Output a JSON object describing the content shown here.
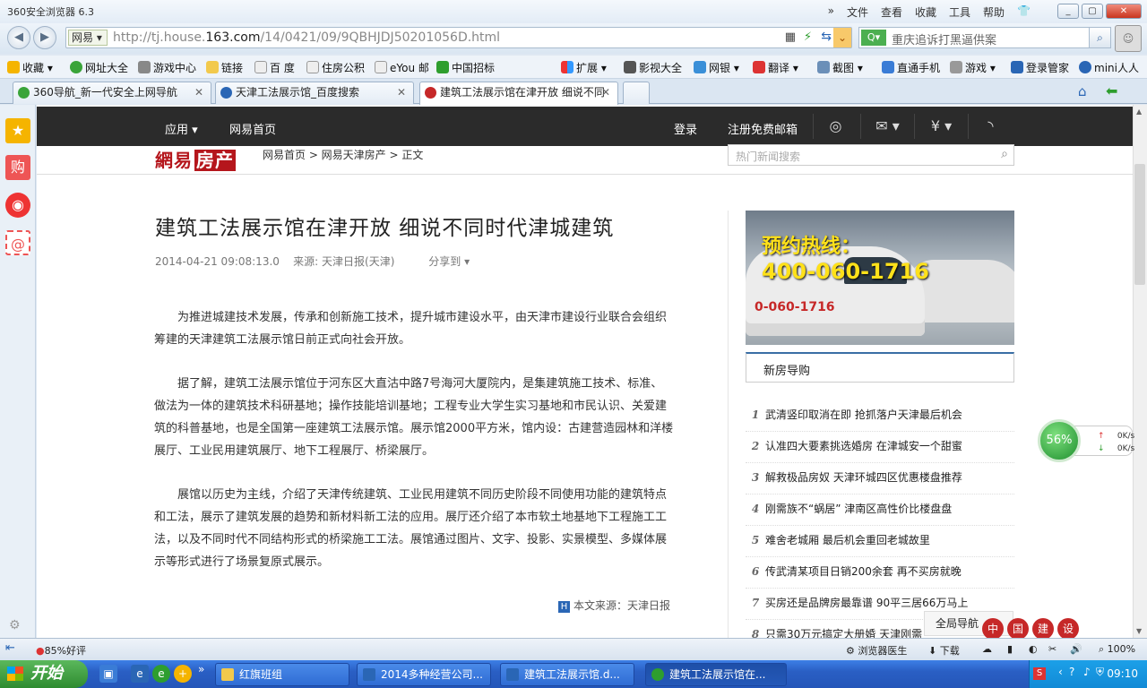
{
  "browser": {
    "title": "360安全浏览器 6.3",
    "menu": [
      "»",
      "文件",
      "查看",
      "收藏",
      "工具",
      "帮助"
    ],
    "window_buttons": [
      "_",
      "▢",
      "✕"
    ],
    "address": {
      "engine": "网易",
      "url_pre": "http://tj.house.",
      "url_domain": "163.com",
      "url_post": "/14/0421/09/9QBHJDJ50201056D.html"
    },
    "search": {
      "placeholder": "重庆追诉打黑逼供案"
    },
    "favorites": [
      "收藏",
      "网址大全",
      "游戏中心",
      "链接",
      "百 度",
      "住房公积",
      "eYou 邮",
      "中国招标",
      "扩展",
      "影视大全",
      "网银",
      "翻译",
      "截图",
      "直通手机",
      "游戏",
      "登录管家",
      "mini人人"
    ],
    "tabs": [
      {
        "label": "360导航_新一代安全上网导航",
        "close": "✕"
      },
      {
        "label": "天津工法展示馆_百度搜索",
        "close": "✕"
      },
      {
        "label": "建筑工法展示馆在津开放 细说不同",
        "close": "✕"
      }
    ]
  },
  "site": {
    "topnav": {
      "app": "应用",
      "home": "网易首页",
      "login": "登录",
      "register": "注册免费邮箱"
    },
    "logo": {
      "part1": "網易",
      "part2": "房产"
    },
    "breadcrumb": "网易首页  >  网易天津房产  >  正文",
    "news_search_placeholder": "热门新闻搜索"
  },
  "article": {
    "title": "建筑工法展示馆在津开放  细说不同时代津城建筑",
    "time": "2014-04-21 09:08:13.0",
    "source": "来源: 天津日报(天津)",
    "share": "分享到",
    "paragraphs": [
      "为推进城建技术发展，传承和创新施工技术，提升城市建设水平，由天津市建设行业联合会组织筹建的天津建筑工法展示馆日前正式向社会开放。",
      "据了解，建筑工法展示馆位于河东区大直沽中路7号海河大厦院内，是集建筑施工技术、标准、做法为一体的建筑技术科研基地；操作技能培训基地；工程专业大学生实习基地和市民认识、关爱建筑的科普基地，也是全国第一座建筑工法展示馆。展示馆2000平方米，馆内设：古建营造园林和洋楼展厅、工业民用建筑展厅、地下工程展厅、桥梁展厅。",
      "展馆以历史为主线，介绍了天津传统建筑、工业民用建筑不同历史阶段不同使用功能的建筑特点和工法，展示了建筑发展的趋势和新材料新工法的应用。展厅还介绍了本市软土地基地下工程施工工法，以及不同时代不同结构形式的桥梁施工工法。展馆通过图片、文字、投影、实景模型、多媒体展示等形式进行了场景复原式展示。"
    ],
    "origin": "本文来源：天津日报"
  },
  "ad": {
    "hotline_label": "预约热线：",
    "hotline_number": "400-060-1716",
    "van_text": "0-060-1716"
  },
  "sidebar_guide": {
    "title": "新房导购",
    "items": [
      {
        "n": "1",
        "text": "武清竖印取消在即  抢抓落户天津最后机会"
      },
      {
        "n": "2",
        "text": "认准四大要素挑选婚房  在津城安一个甜蜜"
      },
      {
        "n": "3",
        "text": "解救极品房奴  天津环城四区优惠楼盘推荐"
      },
      {
        "n": "4",
        "text": "刚需族不“蜗居”  津南区高性价比楼盘盘"
      },
      {
        "n": "5",
        "text": "难舍老城厢  最后机会重回老城故里"
      },
      {
        "n": "6",
        "text": "传武清某项目日销200余套  再不买房就晚"
      },
      {
        "n": "7",
        "text": "买房还是品牌房最靠谱  90平三居66万马上"
      },
      {
        "n": "8",
        "text": "只需30万元搞定大册婚  天津刚需"
      }
    ]
  },
  "float": {
    "speed_percent": "56%",
    "up": "0K/s",
    "down": "0K/s",
    "quick_nav": "全局导航",
    "stamp": [
      "中",
      "国",
      "建",
      "设"
    ]
  },
  "statusbar": {
    "rating": "85%好评",
    "doctor": "浏览器医生",
    "download": "下载",
    "zoom": "100%"
  },
  "taskbar": {
    "start": "开始",
    "tasks": [
      "红旗班组",
      "2014多种经营公司...",
      "建筑工法展示馆.d...",
      "建筑工法展示馆在..."
    ],
    "time": "09:10"
  }
}
